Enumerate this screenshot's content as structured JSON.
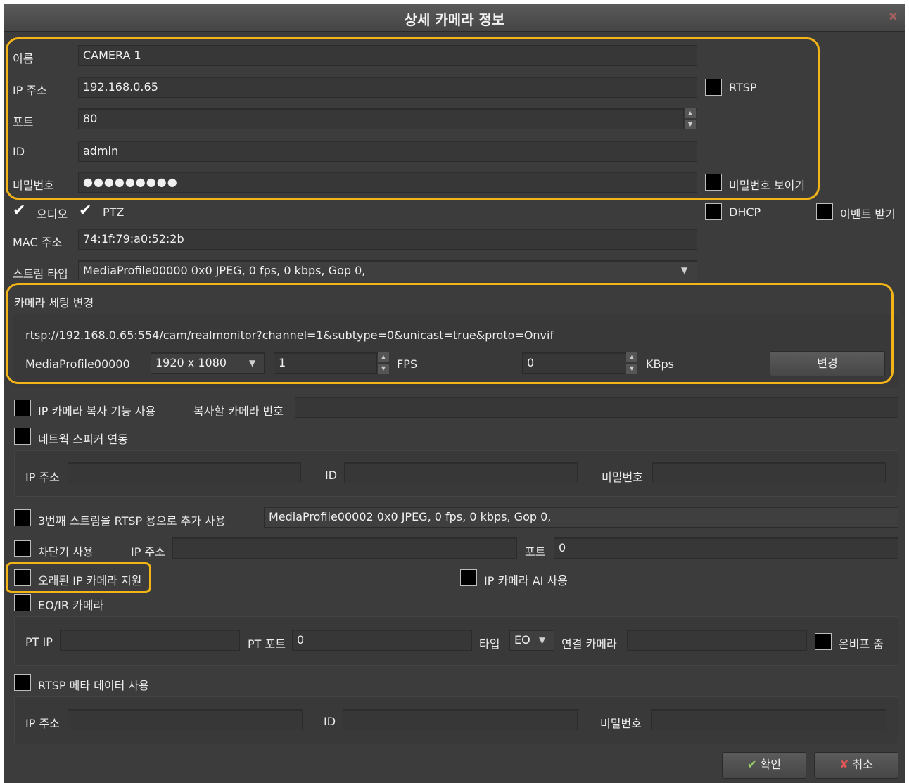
{
  "window": {
    "title": "상세 카메라 정보",
    "close_icon": "close-icon"
  },
  "basic": {
    "name_label": "이름",
    "name_value": "CAMERA 1",
    "ip_label": "IP 주소",
    "ip_value": "192.168.0.65",
    "rtsp_label": "RTSP",
    "port_label": "포트",
    "port_value": "80",
    "id_label": "ID",
    "id_value": "admin",
    "password_label": "비밀번호",
    "password_value": "●●●●●●●●●",
    "show_password_label": "비밀번호 보이기"
  },
  "options": {
    "audio_label": "오디오",
    "audio_checked": true,
    "ptz_label": "PTZ",
    "ptz_checked": true,
    "dhcp_label": "DHCP",
    "event_label": "이벤트 받기",
    "mac_label": "MAC 주소",
    "mac_value": "74:1f:79:a0:52:2b",
    "stream_type_label": "스트림 타입",
    "stream_type_value": "MediaProfile00000 0x0 JPEG, 0 fps, 0 kbps, Gop 0,"
  },
  "camera_settings": {
    "header": "카메라 세팅 변경",
    "rtsp_url": "rtsp://192.168.0.65:554/cam/realmonitor?channel=1&subtype=0&unicast=true&proto=Onvif",
    "profile_label": "MediaProfile00000",
    "resolution": "1920 x 1080",
    "fps_value": "1",
    "fps_label": "FPS",
    "kbps_value": "0",
    "kbps_label": "KBps",
    "change_button": "변경"
  },
  "ip_copy": {
    "label": "IP 카메라 복사 기능 사용",
    "target_label": "복사할 카메라 번호",
    "target_value": ""
  },
  "network_speaker": {
    "label": "네트웍 스피커 연동",
    "ip_label": "IP 주소",
    "id_label": "ID",
    "password_label": "비밀번호"
  },
  "third_stream": {
    "label": "3번째 스트림을 RTSP 용으로 추가 사용",
    "value": "MediaProfile00002 0x0 JPEG, 0 fps, 0 kbps, Gop 0,"
  },
  "breaker": {
    "label": "차단기 사용",
    "ip_label": "IP 주소",
    "port_label": "포트",
    "port_value": "0"
  },
  "legacy": {
    "label": "오래된 IP 카메라 지원",
    "ai_label": "IP 카메라 AI 사용"
  },
  "eoir": {
    "label": "EO/IR 카메라",
    "pt_ip_label": "PT IP",
    "pt_port_label": "PT 포트",
    "pt_port_value": "0",
    "type_label": "타입",
    "type_value": "EO",
    "linked_camera_label": "연결 카메라",
    "onvif_zoom_label": "온비프 줌"
  },
  "rtsp_meta": {
    "label": "RTSP 메타 데이터 사용",
    "ip_label": "IP 주소",
    "id_label": "ID",
    "password_label": "비밀번호"
  },
  "footer": {
    "ok_button": "확인",
    "cancel_button": "취소"
  },
  "colors": {
    "highlight": "#f2b416",
    "background": "#3c3c3c"
  }
}
